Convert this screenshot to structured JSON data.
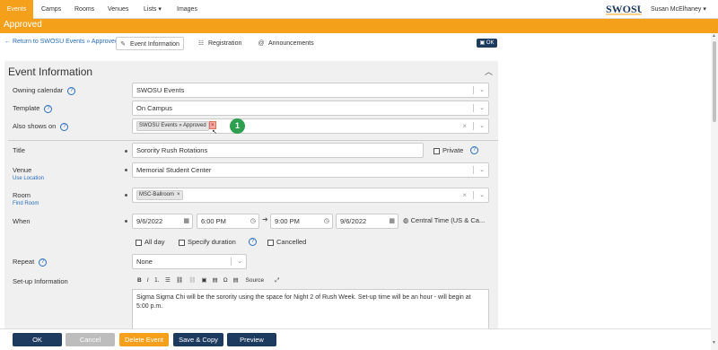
{
  "nav": {
    "items": [
      "Events",
      "Camps",
      "Rooms",
      "Venues",
      "Lists",
      "Images"
    ],
    "lists_caret": "▾",
    "logo_text": "SWOSU",
    "user": "Susan McElhaney"
  },
  "status": "Approved",
  "toolbar": {
    "back": "Return to SWOSU Events » Approved",
    "tabs": [
      "Event Information",
      "Registration",
      "Announcements"
    ],
    "ok_label": "OK"
  },
  "form": {
    "title": "Event Information",
    "owning_calendar_label": "Owning calendar",
    "owning_calendar_value": "SWOSU Events",
    "template_label": "Template",
    "template_value": "On Campus",
    "also_shows_label": "Also shows on",
    "also_shows_tag": "SWOSU Events » Approved",
    "step_badge": "1",
    "title_label": "Title",
    "title_value": "Sorority Rush Rotations",
    "private_label": "Private",
    "venue_label": "Venue",
    "venue_link": "Use Location",
    "venue_value": "Memorial Student Center",
    "room_label": "Room",
    "room_link": "Find Room",
    "room_tag": "MSC-Ballroom",
    "when_label": "When",
    "start_date": "9/6/2022",
    "start_time": "6:00 PM",
    "end_time": "9:00 PM",
    "end_date": "9/6/2022",
    "timezone": "Central Time (US & Ca...",
    "all_day": "All day",
    "specify_duration": "Specify duration",
    "cancelled": "Cancelled",
    "repeat_label": "Repeat",
    "repeat_value": "None",
    "setup_label": "Set-up Information",
    "source_label": "Source",
    "setup_text": "Sigma Sigma Chi will be the sorority using the space for Night 2 of Rush Week. Set-up time will be an hour - will begin at 5:00 p.m."
  },
  "buttons": {
    "ok": "OK",
    "cancel": "Cancel",
    "delete": "Delete Event",
    "save_copy": "Save & Copy",
    "preview": "Preview"
  },
  "colors": {
    "accent": "#f5a01a",
    "navy": "#1d3a5f",
    "link": "#2a6ebb",
    "badge": "#2e9e4f"
  }
}
